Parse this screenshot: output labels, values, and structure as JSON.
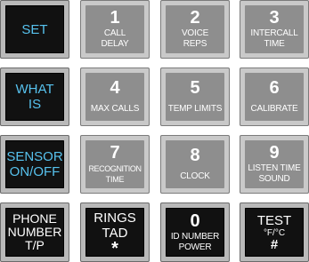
{
  "keypad": {
    "rows": [
      [
        {
          "lines": [
            "SET"
          ]
        },
        {
          "num": "1",
          "lines": [
            "CALL",
            "DELAY"
          ]
        },
        {
          "num": "2",
          "lines": [
            "VOICE",
            "REPS"
          ]
        },
        {
          "num": "3",
          "lines": [
            "INTERCALL",
            "TIME"
          ]
        }
      ],
      [
        {
          "lines": [
            "WHAT",
            "IS"
          ]
        },
        {
          "num": "4",
          "lines": [
            "MAX CALLS"
          ]
        },
        {
          "num": "5",
          "lines": [
            "TEMP LIMITS"
          ]
        },
        {
          "num": "6",
          "lines": [
            "CALIBRATE"
          ]
        }
      ],
      [
        {
          "lines": [
            "SENSOR",
            "ON/OFF"
          ]
        },
        {
          "num": "7",
          "lines": [
            "RECOGNITION",
            "TIME"
          ]
        },
        {
          "num": "8",
          "lines": [
            "CLOCK"
          ]
        },
        {
          "num": "9",
          "lines": [
            "LISTEN TIME",
            "SOUND"
          ]
        }
      ],
      [
        {
          "lines": [
            "PHONE",
            "NUMBER",
            "T/P"
          ]
        },
        {
          "lines": [
            "RINGS",
            "TAD"
          ],
          "symbol": "*"
        },
        {
          "num": "0",
          "lines": [
            "ID NUMBER",
            "POWER"
          ]
        },
        {
          "lines": [
            "TEST",
            "°F/°C"
          ],
          "symbol": "#"
        }
      ]
    ]
  },
  "colors": {
    "function_key_text": "#57c2ee",
    "number_key_text": "#ffffff",
    "dark_key_face": "#111111",
    "gray_key_face": "#8e8e8e"
  }
}
